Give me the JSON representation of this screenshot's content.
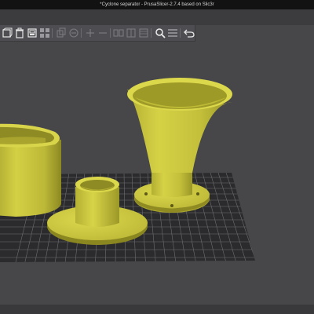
{
  "window": {
    "title": "*Cyclone separator - PrusaSlicer-2.7.4 based on Slic3r"
  },
  "toolbar": {
    "buttons": [
      {
        "name": "add-icon",
        "enabled": true
      },
      {
        "name": "delete-icon",
        "enabled": true
      },
      {
        "name": "delete-all-icon",
        "enabled": true
      },
      {
        "name": "arrange-icon",
        "enabled": true
      },
      {
        "name": "copy-icon",
        "enabled": false
      },
      {
        "name": "paste-icon",
        "enabled": false
      },
      {
        "name": "add-instance-icon",
        "enabled": false
      },
      {
        "name": "remove-instance-icon",
        "enabled": false
      },
      {
        "name": "split-objects-icon",
        "enabled": false
      },
      {
        "name": "split-parts-icon",
        "enabled": false
      },
      {
        "name": "variable-layer-height-icon",
        "enabled": false
      },
      {
        "name": "search-icon",
        "enabled": true
      },
      {
        "name": "layers-icon",
        "enabled": true
      },
      {
        "name": "undo-icon",
        "enabled": true
      }
    ]
  },
  "viewport": {
    "objects": [
      "large-cylinder-object",
      "funnel-object",
      "flanged-tube-object"
    ],
    "colors": {
      "background": "#47474a",
      "bed": "#2b2b2d",
      "grid_line": "#6e6e72",
      "model": "#c9c53c",
      "model_shadow": "#8a8620",
      "model_light": "#e0dc5a"
    }
  }
}
